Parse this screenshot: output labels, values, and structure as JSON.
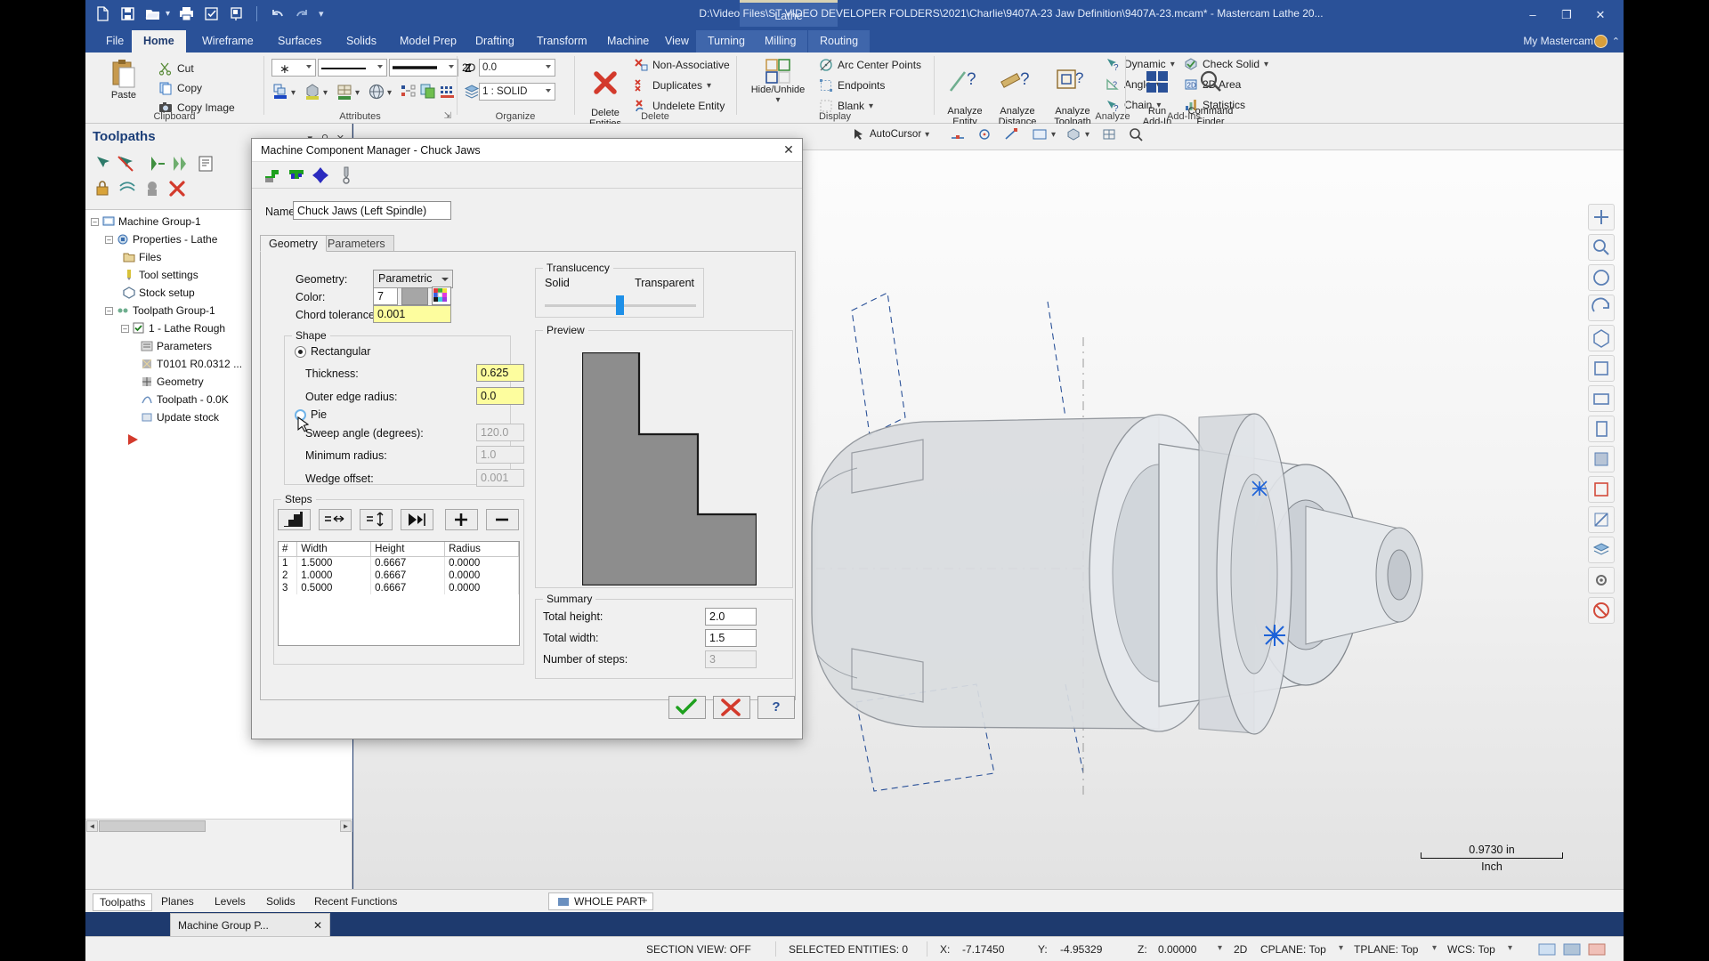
{
  "window": {
    "file_path": "D:\\Video Files\\ST VIDEO DEVELOPER FOLDERS\\2021\\Charlie\\9407A-23 Jaw Definition\\9407A-23.mcam* - Mastercam Lathe 20...",
    "context_tab": "Lathe",
    "user": "My Mastercam",
    "minimize": "–",
    "maximize": "❐",
    "close": "✕",
    "ribbon_collapse": "⌃"
  },
  "quick_access": [
    {
      "name": "new-icon",
      "tip": "New"
    },
    {
      "name": "save-icon",
      "tip": "Save"
    },
    {
      "name": "open-icon",
      "tip": "Open"
    },
    {
      "name": "print-icon",
      "tip": "Print"
    },
    {
      "name": "verify-icon",
      "tip": "Verify"
    },
    {
      "name": "backplot-icon",
      "tip": "Backplot"
    },
    {
      "name": "undo-icon",
      "tip": "Undo"
    },
    {
      "name": "redo-icon",
      "tip": "Redo"
    },
    {
      "name": "customize-icon",
      "tip": "Customize"
    }
  ],
  "ribbon_tabs": [
    {
      "label": "File",
      "active": false,
      "group": false
    },
    {
      "label": "Home",
      "active": true,
      "group": false
    },
    {
      "label": "Wireframe",
      "active": false,
      "group": false
    },
    {
      "label": "Surfaces",
      "active": false,
      "group": false
    },
    {
      "label": "Solids",
      "active": false,
      "group": false
    },
    {
      "label": "Model Prep",
      "active": false,
      "group": false
    },
    {
      "label": "Drafting",
      "active": false,
      "group": false
    },
    {
      "label": "Transform",
      "active": false,
      "group": false
    },
    {
      "label": "Machine",
      "active": false,
      "group": false
    },
    {
      "label": "View",
      "active": false,
      "group": false
    },
    {
      "label": "Turning",
      "active": false,
      "group": true
    },
    {
      "label": "Milling",
      "active": false,
      "group": true
    },
    {
      "label": "Routing",
      "active": false,
      "group": true
    }
  ],
  "ribbon": {
    "clipboard": {
      "label": "Clipboard",
      "paste": "Paste",
      "cut": "Cut",
      "copy": "Copy",
      "copy_image": "Copy Image"
    },
    "attributes": {
      "label": "Attributes",
      "plane_2d": "2D",
      "z_label": "Z",
      "z_value": "0.0",
      "level_value": "1 : SOLID"
    },
    "organize": {
      "label": "Organize"
    },
    "delete": {
      "label": "Delete",
      "delete_entities": "Delete\nEntities",
      "non_associative": "Non-Associative",
      "duplicates": "Duplicates",
      "undelete_entity": "Undelete Entity"
    },
    "display": {
      "label": "Display",
      "hide_unhide": "Hide/Unhide",
      "arc_center_points": "Arc Center Points",
      "endpoints": "Endpoints",
      "blank": "Blank"
    },
    "analyze": {
      "label": "Analyze",
      "analyze_entity": "Analyze\nEntity",
      "analyze_distance": "Analyze\nDistance",
      "analyze_toolpath": "Analyze\nToolpath",
      "dynamic": "Dynamic",
      "angle": "Angle",
      "chain": "Chain",
      "check_solid": "Check Solid",
      "area_2d": "2D Area",
      "statistics": "Statistics"
    },
    "addins": {
      "label": "Add-Ins",
      "run_addin": "Run\nAdd-In",
      "command_finder": "Command\nFinder"
    }
  },
  "toolpaths_panel": {
    "title": "Toolpaths",
    "tree": [
      {
        "label": "Machine Group-1",
        "indent": 0,
        "icon": "machine-group-icon"
      },
      {
        "label": "Properties - Lathe",
        "indent": 1,
        "icon": "properties-icon"
      },
      {
        "label": "Files",
        "indent": 2,
        "icon": "files-icon"
      },
      {
        "label": "Tool settings",
        "indent": 2,
        "icon": "tool-settings-icon"
      },
      {
        "label": "Stock setup",
        "indent": 2,
        "icon": "stock-setup-icon"
      },
      {
        "label": "Toolpath Group-1",
        "indent": 1,
        "icon": "toolpath-group-icon"
      },
      {
        "label": "1 - Lathe Rough",
        "indent": 2,
        "icon": "operation-icon"
      },
      {
        "label": "Parameters",
        "indent": 3,
        "icon": "parameters-icon"
      },
      {
        "label": "T0101 R0.0312 ...",
        "indent": 3,
        "icon": "tool-icon"
      },
      {
        "label": "Geometry",
        "indent": 3,
        "icon": "geometry-icon"
      },
      {
        "label": "Toolpath - 0.0K",
        "indent": 3,
        "icon": "toolpath-icon"
      },
      {
        "label": "Update stock",
        "indent": 3,
        "icon": "update-stock-icon"
      }
    ]
  },
  "graphics_toolbar": {
    "autocursor": "AutoCursor"
  },
  "viewport": {
    "scale_value": "0.9730 in",
    "scale_units": "Inch"
  },
  "dialog": {
    "title": "Machine Component Manager - Chuck Jaws",
    "close": "✕",
    "toolbar_icons": [
      {
        "name": "chuck-jaw-step-icon"
      },
      {
        "name": "chuck-jaw-flat-icon"
      },
      {
        "name": "chuck-body-icon"
      },
      {
        "name": "center-tailstock-icon"
      }
    ],
    "name_label": "Name:",
    "name_value": "Chuck Jaws (Left Spindle)",
    "tabs": [
      {
        "label": "Geometry",
        "active": true
      },
      {
        "label": "Parameters",
        "active": false
      }
    ],
    "geometry": {
      "geometry_label": "Geometry:",
      "geometry_value": "Parametric",
      "color_label": "Color:",
      "color_value": "7",
      "color_swatch": "#a6a6a6",
      "chord_label": "Chord tolerance:",
      "chord_value": "0.001"
    },
    "shape": {
      "group_label": "Shape",
      "rectangular_label": "Rectangular",
      "rectangular_selected": true,
      "thickness_label": "Thickness:",
      "thickness_value": "0.625",
      "outer_edge_radius_label": "Outer edge radius:",
      "outer_edge_radius_value": "0.0",
      "pie_label": "Pie",
      "pie_selected": false,
      "sweep_angle_label": "Sweep angle (degrees):",
      "sweep_angle_value": "120.0",
      "minimum_radius_label": "Minimum radius:",
      "minimum_radius_value": "1.0",
      "wedge_offset_label": "Wedge offset:",
      "wedge_offset_value": "0.001"
    },
    "translucency": {
      "group_label": "Translucency",
      "solid_label": "Solid",
      "transparent_label": "Transparent",
      "value_percent": 48
    },
    "preview": {
      "group_label": "Preview"
    },
    "steps": {
      "group_label": "Steps",
      "buttons": [
        {
          "name": "step-shape-button"
        },
        {
          "name": "equal-width-button"
        },
        {
          "name": "equal-height-button"
        },
        {
          "name": "reverse-steps-button"
        },
        {
          "name": "add-step-button",
          "glyph": "+"
        },
        {
          "name": "remove-step-button",
          "glyph": "–"
        }
      ],
      "columns": [
        "#",
        "Width",
        "Height",
        "Radius"
      ],
      "rows": [
        {
          "num": "1",
          "width": "1.5000",
          "height": "0.6667",
          "radius": "0.0000"
        },
        {
          "num": "2",
          "width": "1.0000",
          "height": "0.6667",
          "radius": "0.0000"
        },
        {
          "num": "3",
          "width": "0.5000",
          "height": "0.6667",
          "radius": "0.0000"
        }
      ]
    },
    "summary": {
      "group_label": "Summary",
      "total_height_label": "Total height:",
      "total_height_value": "2.0",
      "total_width_label": "Total width:",
      "total_width_value": "1.5",
      "number_of_steps_label": "Number of steps:",
      "number_of_steps_value": "3"
    },
    "footer": {
      "ok": "✓",
      "cancel": "✕",
      "help": "?"
    }
  },
  "bottom_tabs": [
    {
      "label": "Toolpaths",
      "active": true
    },
    {
      "label": "Planes",
      "active": false
    },
    {
      "label": "Levels",
      "active": false
    },
    {
      "label": "Solids",
      "active": false
    },
    {
      "label": "Recent Functions",
      "active": false
    }
  ],
  "whole_part": {
    "label": "WHOLE PART",
    "add": "+"
  },
  "machine_group_tab": {
    "label": "Machine Group P...",
    "close": "✕"
  },
  "statusbar": {
    "section_view": "SECTION VIEW: OFF",
    "selected_entities": "SELECTED ENTITIES: 0",
    "x_label": "X:",
    "x_value": "-7.17450",
    "y_label": "Y:",
    "y_value": "-4.95329",
    "z_label": "Z:",
    "z_value": "0.00000",
    "mode": "2D",
    "cplane": "CPLANE: Top",
    "tplane": "TPLANE: Top",
    "wcs": "WCS: Top"
  },
  "colors": {
    "titlebar": "#2a5198",
    "ribbon_bg": "#f0f0f0",
    "accent_yellow": "#fdfd9e",
    "slider_blue": "#1e90e8",
    "ok_green": "#27a527",
    "cancel_red": "#d33a2c"
  }
}
